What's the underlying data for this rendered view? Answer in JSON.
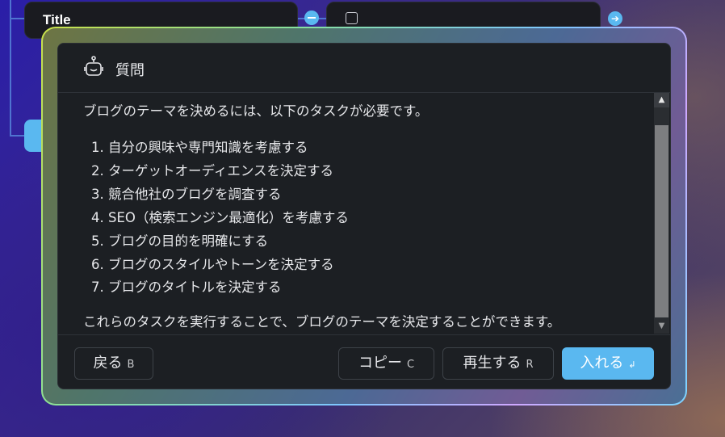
{
  "canvas": {
    "title_node_label": "Title",
    "next_icon_glyph": "➔"
  },
  "modal": {
    "title": "質問",
    "icon": "robot-icon",
    "content": {
      "intro": "ブログのテーマを決めるには、以下のタスクが必要です。",
      "steps": [
        "1. 自分の興味や専門知識を考慮する",
        "2. ターゲットオーディエンスを決定する",
        "3. 競合他社のブログを調査する",
        "4. SEO（検索エンジン最適化）を考慮する",
        "5. ブログの目的を明確にする",
        "6. ブログのスタイルやトーンを決定する",
        "7. ブログのタイトルを決定する"
      ],
      "outro": "これらのタスクを実行することで、ブログのテーマを決定することができます。"
    },
    "buttons": {
      "back": {
        "label": "戻る",
        "key": "B"
      },
      "copy": {
        "label": "コピー",
        "key": "C"
      },
      "regenerate": {
        "label": "再生する",
        "key": "R"
      },
      "insert": {
        "label": "入れる",
        "key": "↲"
      }
    }
  },
  "colors": {
    "accent": "#5ab8f0",
    "modal_bg": "#1c1f23"
  }
}
